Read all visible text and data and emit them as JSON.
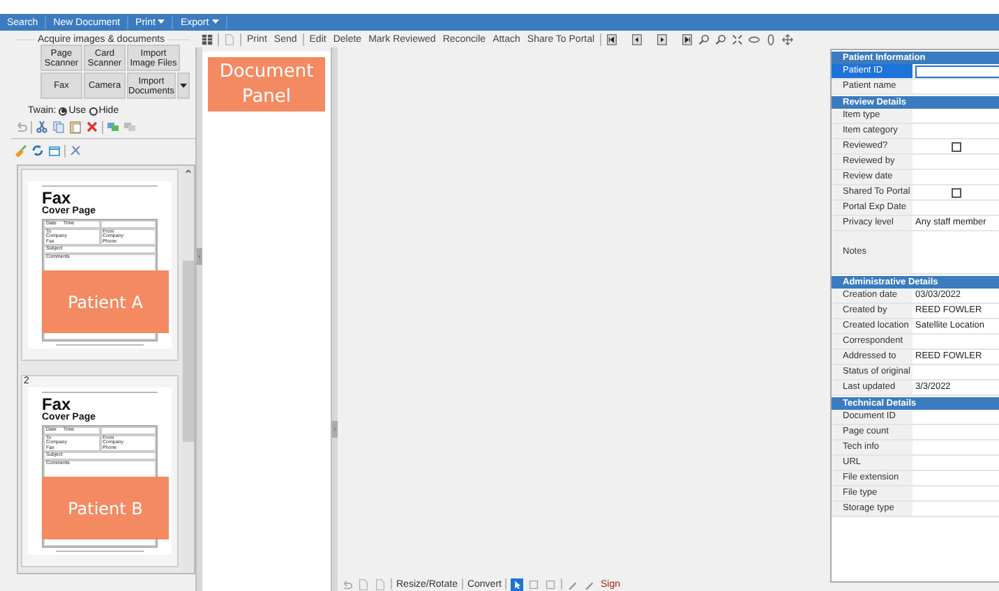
{
  "menu": [
    {
      "label": "Search",
      "has_menu": false
    },
    {
      "label": "New Document",
      "has_menu": false
    },
    {
      "label": "Print",
      "has_menu": true
    },
    {
      "label": "Export",
      "has_menu": true
    }
  ],
  "acquire": {
    "title": "Acquire images & documents",
    "buttons": [
      {
        "label": "Page Scanner",
        "has_menu": false
      },
      {
        "label": "Card Scanner",
        "has_menu": false
      },
      {
        "label": "Import Image Files",
        "has_menu": false
      },
      {
        "label": "Fax",
        "has_menu": false
      },
      {
        "label": "Camera",
        "has_menu": false
      },
      {
        "label": "Import Documents",
        "has_menu": true
      }
    ],
    "twain": {
      "label": "Twain:",
      "options": [
        {
          "label": "Use",
          "selected": true
        },
        {
          "label": "Hide",
          "selected": false
        }
      ]
    }
  },
  "thumbnails": [
    {
      "document": {
        "title": "Fax",
        "subtitle": "Cover Page",
        "labels": [
          "Date",
          "Time",
          "To",
          "Company",
          "Fax",
          "From",
          "Company",
          "Phone",
          "Subject",
          "Comments"
        ]
      },
      "overlay": "Patient A"
    },
    {
      "page_number": "2",
      "document": {
        "title": "Fax",
        "subtitle": "Cover Page",
        "labels": [
          "Date",
          "Time",
          "To",
          "Company",
          "Fax",
          "From",
          "Company",
          "Phone",
          "Subject",
          "Comments"
        ]
      },
      "overlay": "Patient B"
    }
  ],
  "document_panel": {
    "label": "Document Panel"
  },
  "toolbar": [
    {
      "label": "Print",
      "disabled": false
    },
    {
      "label": "Send",
      "disabled": false
    },
    {
      "label": "Edit",
      "disabled": false
    },
    {
      "label": "Delete",
      "disabled": false
    },
    {
      "label": "Mark Reviewed",
      "disabled": false
    },
    {
      "label": "Reconcile",
      "disabled": false
    },
    {
      "label": "Attach",
      "disabled": false
    },
    {
      "label": "Share To Portal",
      "disabled": false
    }
  ],
  "bottom_toolbar": [
    {
      "label": "Resize/Rotate",
      "accent": false
    },
    {
      "label": "Convert",
      "accent": false
    },
    {
      "label": "Sign",
      "accent": true
    }
  ],
  "properties": [
    {
      "title": "Patient Information",
      "rows": [
        {
          "label": "Patient ID",
          "kind": "input",
          "value": "",
          "selected": true
        },
        {
          "label": "Patient name",
          "kind": "text",
          "value": "",
          "selected": false
        }
      ]
    },
    {
      "title": "Review Details",
      "rows": [
        {
          "label": "Item type",
          "kind": "text",
          "value": "",
          "selected": false
        },
        {
          "label": "Item category",
          "kind": "text",
          "value": "",
          "selected": false
        },
        {
          "label": "Reviewed?",
          "kind": "checkbox",
          "checked": false,
          "selected": false
        },
        {
          "label": "Reviewed by",
          "kind": "text",
          "value": "",
          "selected": false
        },
        {
          "label": "Review date",
          "kind": "text",
          "value": "",
          "selected": false
        },
        {
          "label": "Shared To Portal",
          "kind": "checkbox",
          "checked": false,
          "selected": false
        },
        {
          "label": "Portal Exp Date",
          "kind": "text",
          "value": "",
          "selected": false
        },
        {
          "label": "Privacy level",
          "kind": "text",
          "value": "Any staff member",
          "selected": false
        },
        {
          "label": "Notes",
          "kind": "notes",
          "value": "",
          "selected": false
        }
      ]
    },
    {
      "title": "Administrative Details",
      "rows": [
        {
          "label": "Creation date",
          "kind": "text",
          "value": "03/03/2022",
          "selected": false
        },
        {
          "label": "Created by",
          "kind": "text",
          "value": "REED FOWLER",
          "selected": false
        },
        {
          "label": "Created location",
          "kind": "text",
          "value": "Satellite Location",
          "selected": false
        },
        {
          "label": "Correspondent",
          "kind": "text",
          "value": "",
          "selected": false
        },
        {
          "label": "Addressed to",
          "kind": "text",
          "value": "REED FOWLER",
          "selected": false
        },
        {
          "label": "Status of original",
          "kind": "text",
          "value": "",
          "selected": false
        },
        {
          "label": "Last updated",
          "kind": "text",
          "value": "3/3/2022",
          "selected": false
        }
      ]
    },
    {
      "title": "Technical Details",
      "rows": [
        {
          "label": "Document ID",
          "kind": "text",
          "value": "",
          "selected": false
        },
        {
          "label": "Page count",
          "kind": "text",
          "value": "",
          "selected": false
        },
        {
          "label": "Tech info",
          "kind": "text",
          "value": "",
          "selected": false
        },
        {
          "label": "URL",
          "kind": "text",
          "value": "",
          "selected": false
        },
        {
          "label": "File extension",
          "kind": "text",
          "value": "",
          "selected": false
        },
        {
          "label": "File type",
          "kind": "text",
          "value": "",
          "selected": false
        },
        {
          "label": "Storage type",
          "kind": "text",
          "value": "",
          "selected": false
        }
      ]
    }
  ]
}
